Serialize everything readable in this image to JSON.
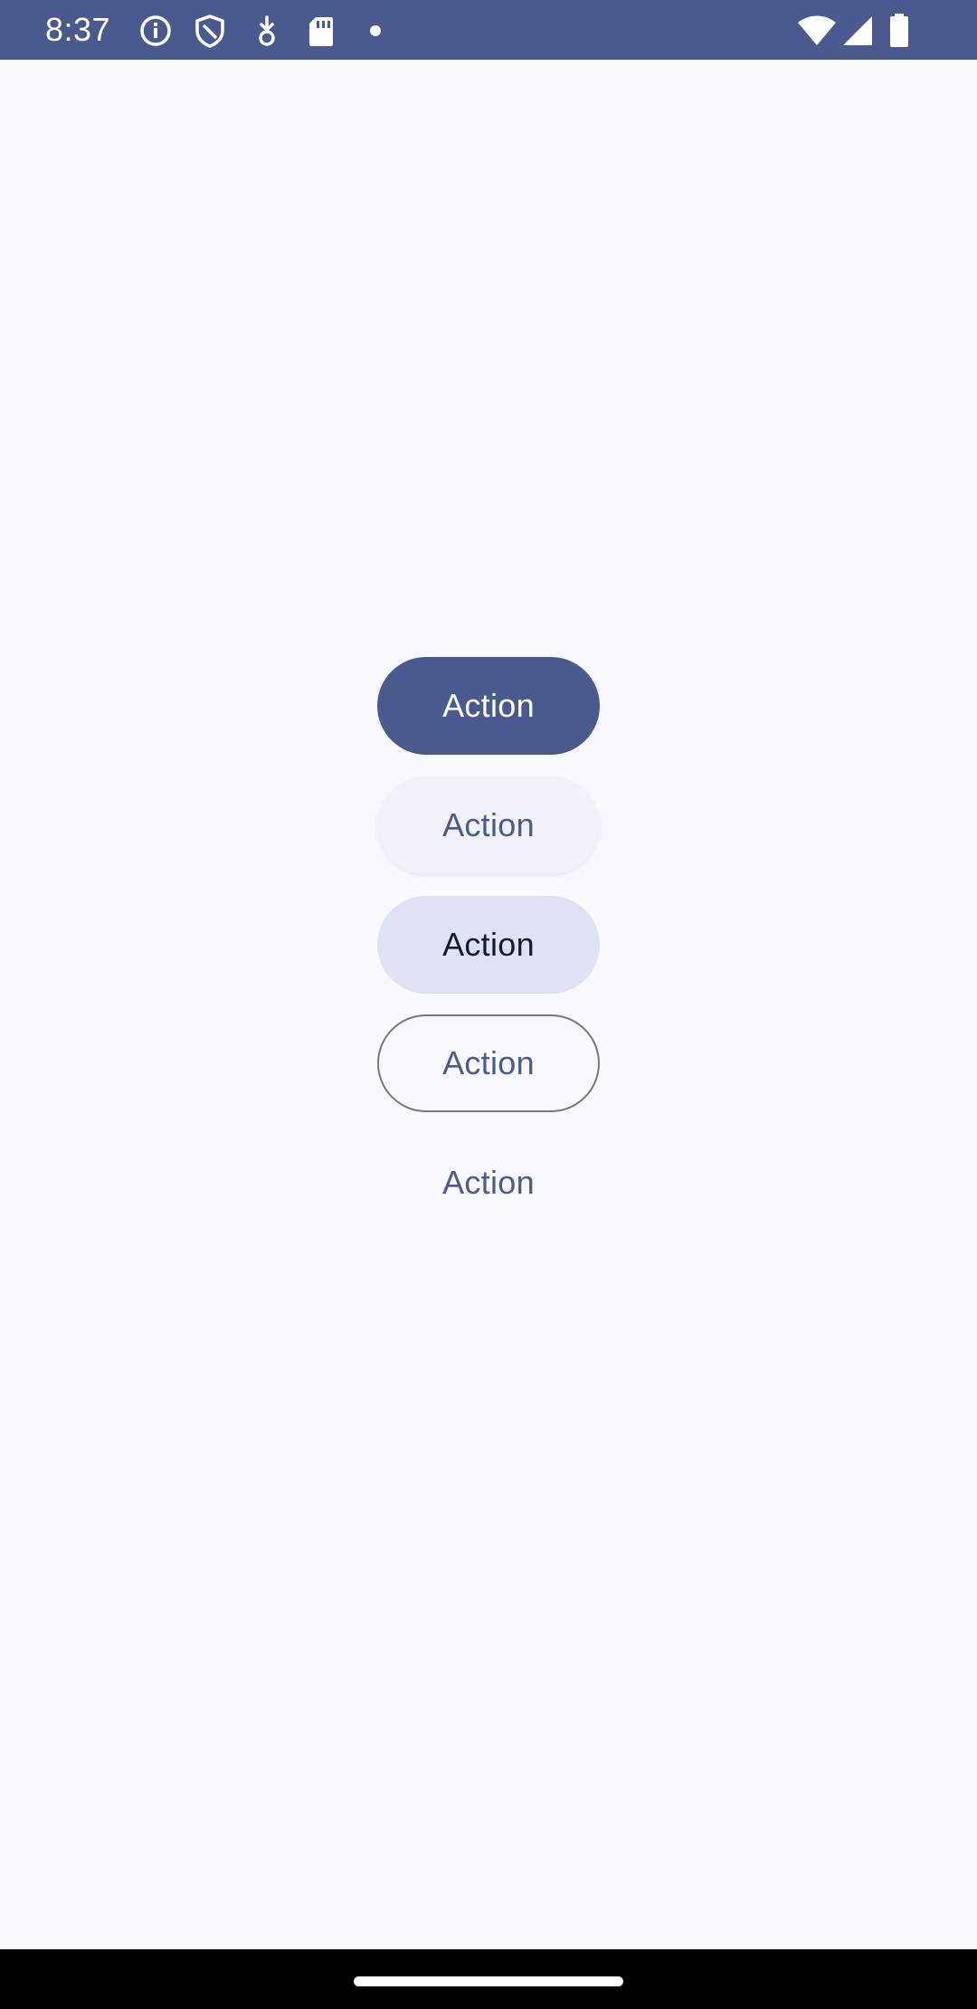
{
  "status_bar": {
    "time": "8:37",
    "left_icons": [
      "info-icon",
      "shield-icon",
      "download-icon",
      "sd-card-icon",
      "notification-dot-icon"
    ],
    "right_icons": [
      "wifi-icon",
      "cell-signal-icon",
      "battery-icon"
    ]
  },
  "buttons": {
    "filled_label": "Action",
    "elevated_label": "Action",
    "tonal_label": "Action",
    "outlined_label": "Action",
    "text_label": "Action"
  },
  "colors": {
    "primary": "#4a5a8e",
    "background": "#f8f9ff",
    "tonal_container": "#dfe1f4",
    "outline": "#737687"
  }
}
